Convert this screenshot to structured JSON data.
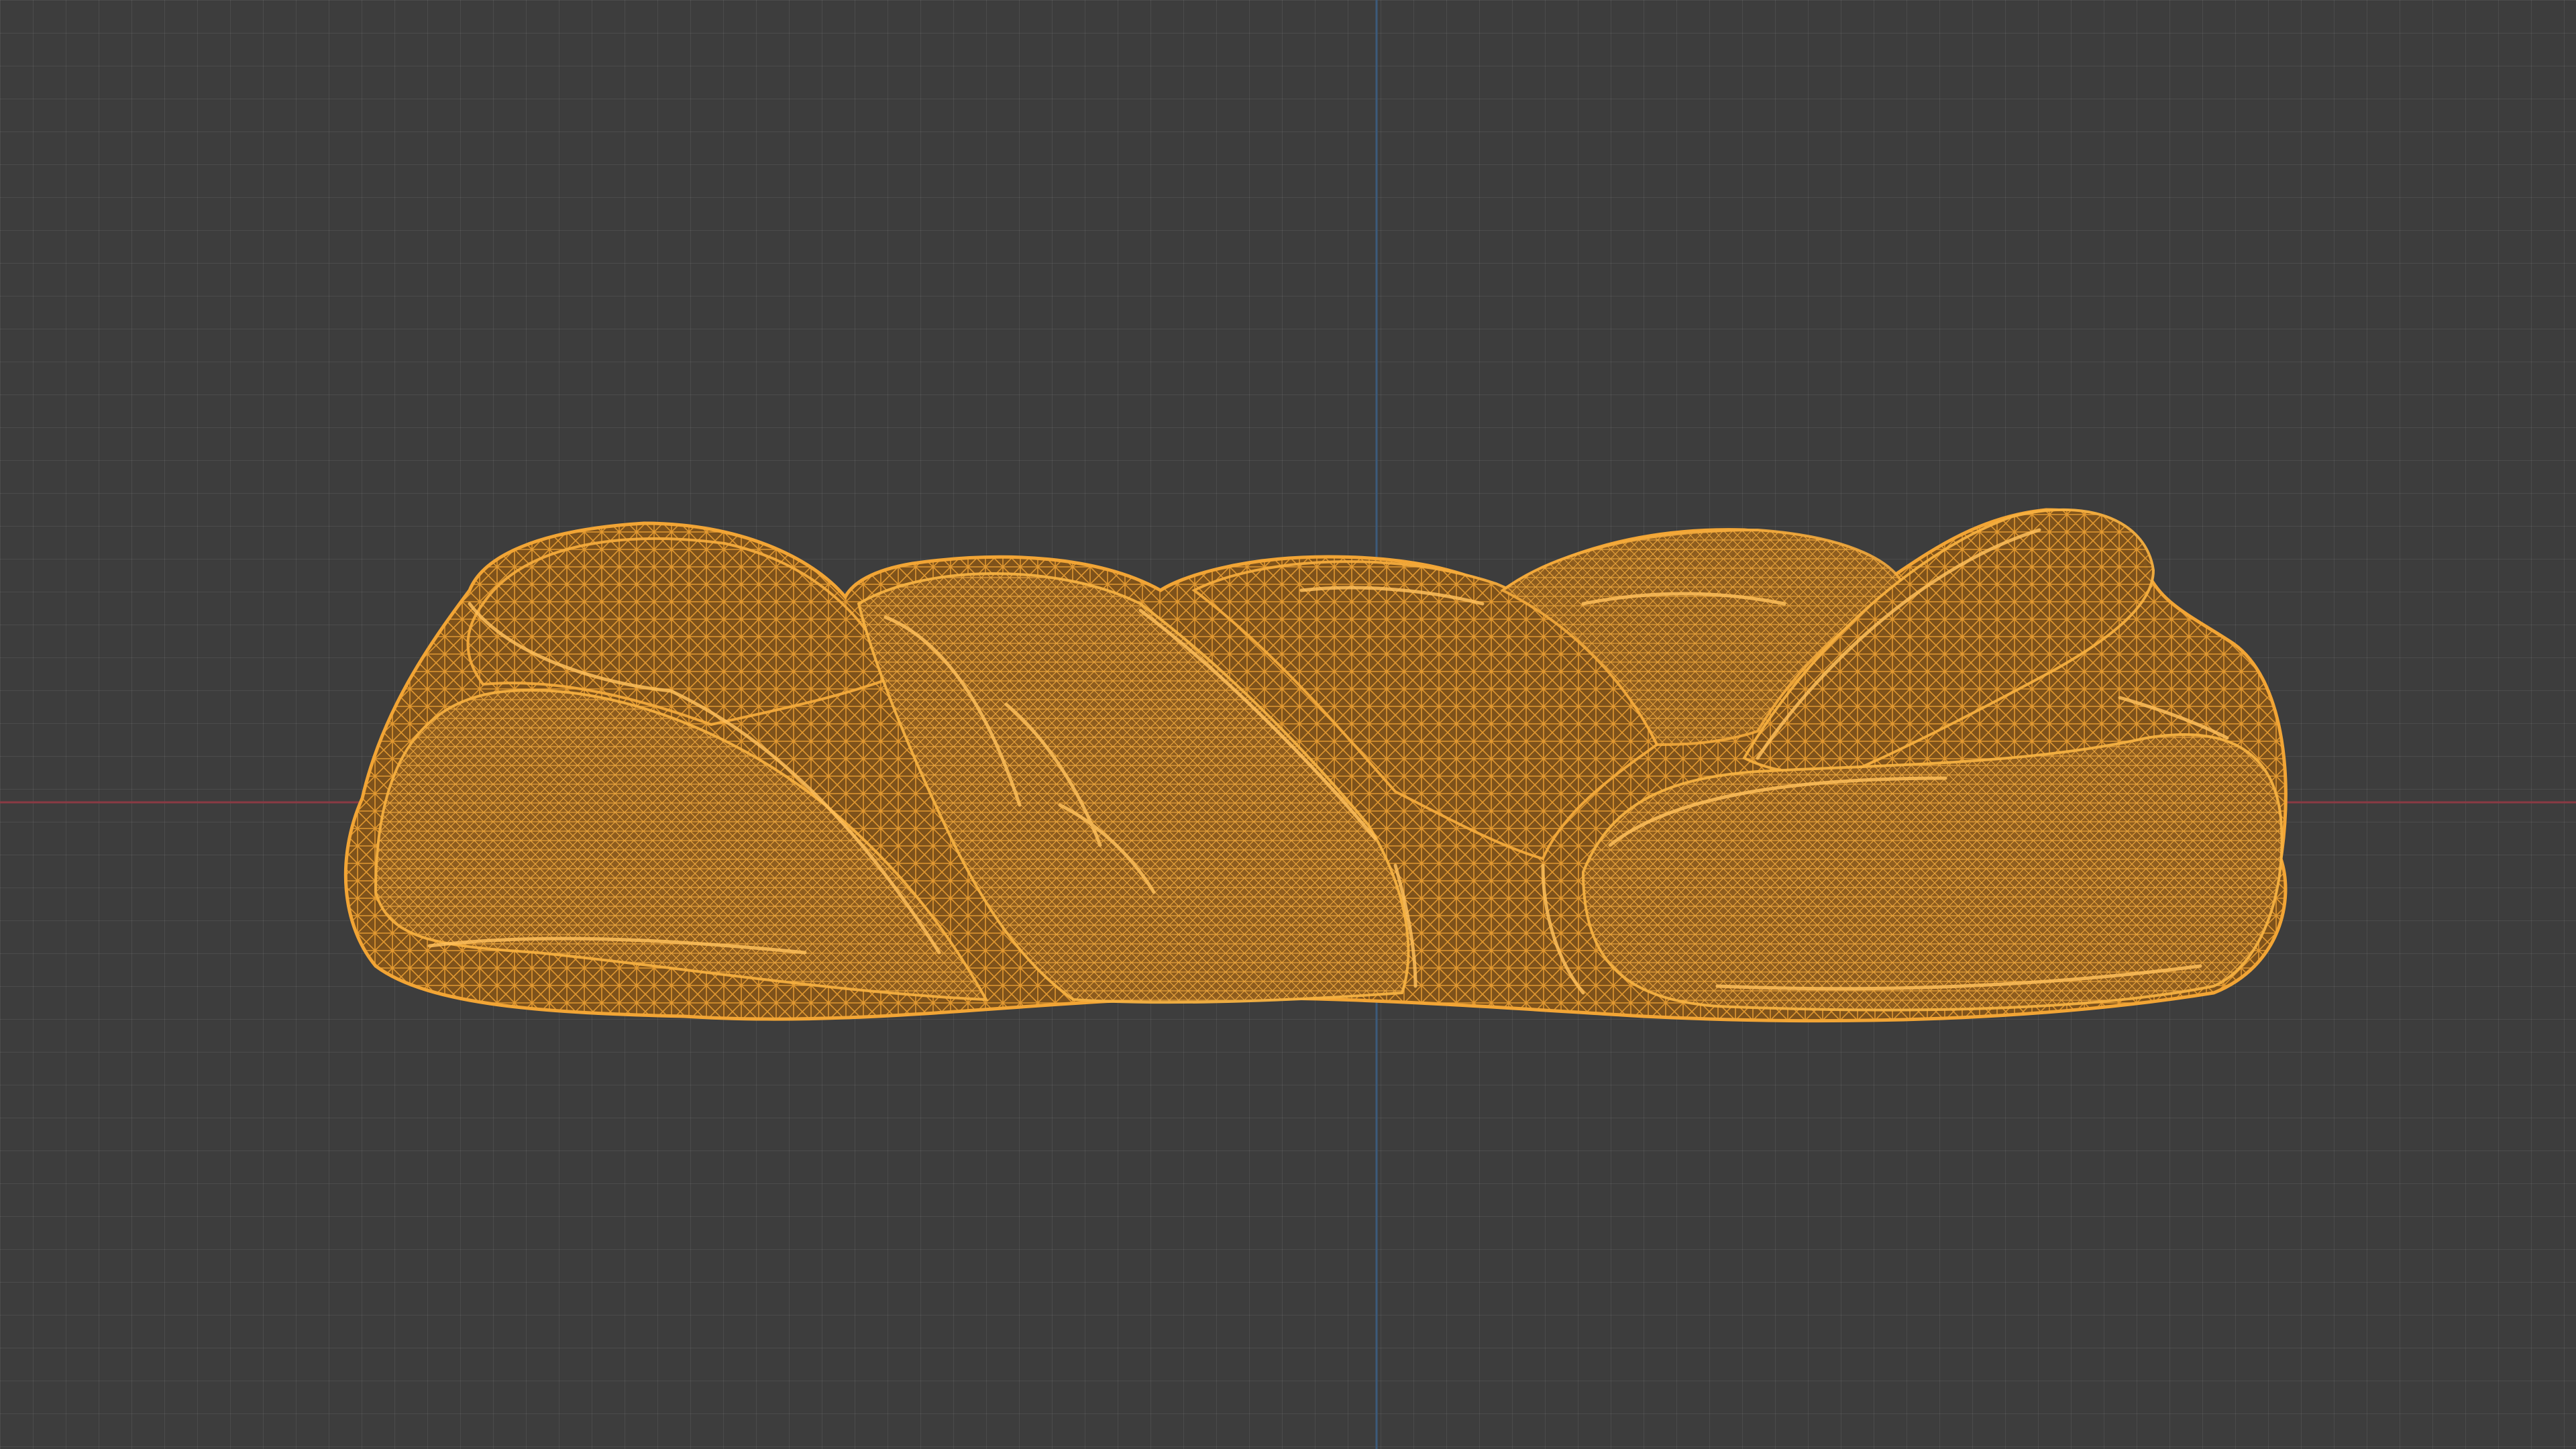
{
  "viewport": {
    "background_color": "#3d3d3d",
    "grid_color": "#4a4a4a",
    "x_axis_color": "#8a3a44",
    "y_axis_color": "#3c5a7a"
  },
  "mesh": {
    "name_hint": "bread-loaf-wireframe",
    "display": "wireframe",
    "wire_color": "#f0a030",
    "fill_color": "#8a5a1e"
  }
}
